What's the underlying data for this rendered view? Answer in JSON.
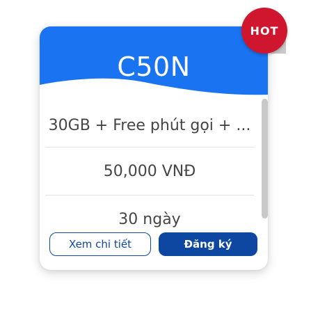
{
  "plan": {
    "name": "C50N",
    "badge": "HOT",
    "details": [
      "30GB + Free phút gọi + ...",
      "50,000 VNĐ",
      "30 ngày"
    ]
  },
  "actions": {
    "details_label": "Xem chi tiết",
    "register_label": "Đăng ký"
  },
  "colors": {
    "header_blue": "#1a73f0",
    "button_blue": "#0d47a1",
    "hot_red": "#d0162e",
    "text_gray": "#454545"
  },
  "icons": [
    "hot-badge-icon"
  ]
}
